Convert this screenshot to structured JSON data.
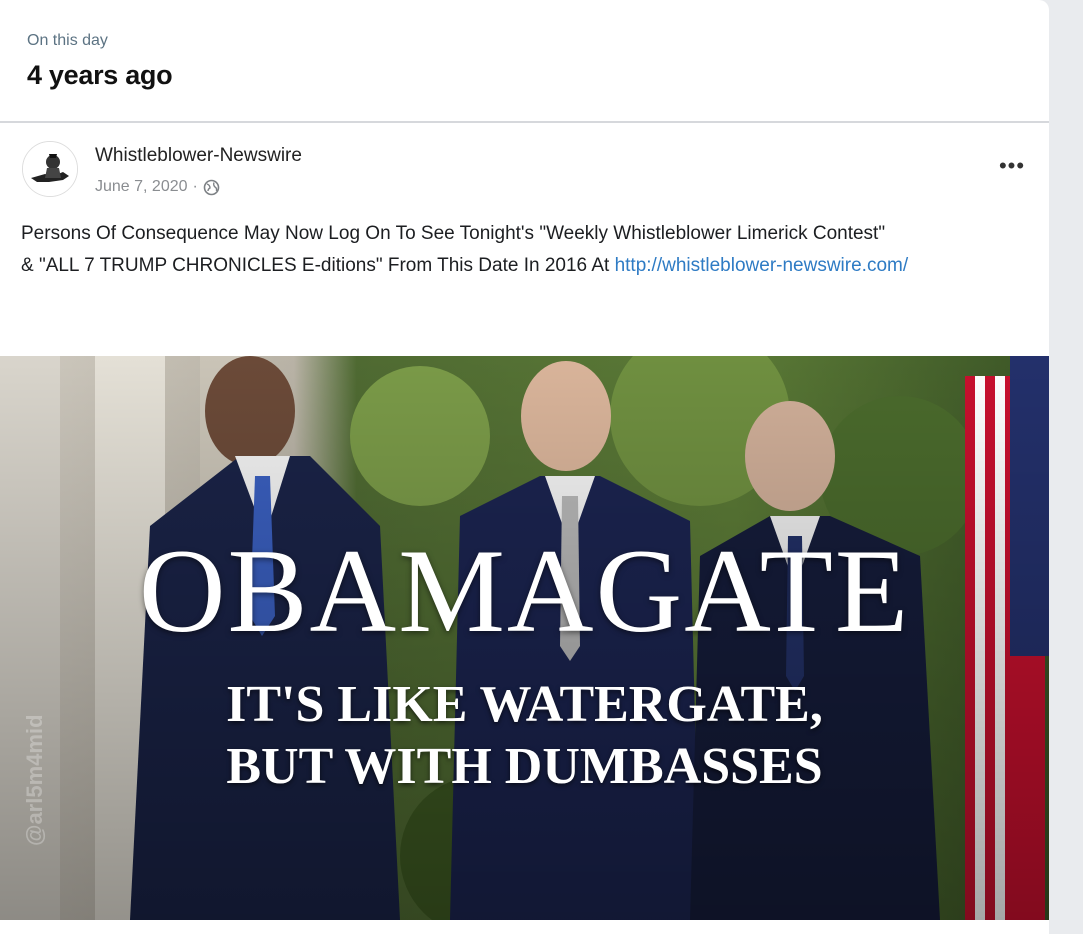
{
  "memory": {
    "subtitle": "On this day",
    "title": "4 years ago"
  },
  "post": {
    "author": "Whistleblower-Newswire",
    "date": "June 7, 2020",
    "separator": "·",
    "privacy_icon": "globe-icon",
    "more_label": "•••",
    "text_line1": "Persons Of Consequence May Now Log On To See Tonight's \"Weekly Whistleblower Limerick Contest\"",
    "text_line2_prefix": "& \"ALL 7 TRUMP CHRONICLES E-ditions\" From This Date In 2016 At ",
    "link": "http://whistleblower-newswire.com/"
  },
  "image": {
    "headline": "OBAMAGATE",
    "caption_line1": "IT'S LIKE WATERGATE,",
    "caption_line2": "BUT WITH DUMBASSES",
    "watermark": "@arl5m4mid"
  },
  "colors": {
    "link": "#2e7bc4",
    "muted": "#8a8d91"
  }
}
